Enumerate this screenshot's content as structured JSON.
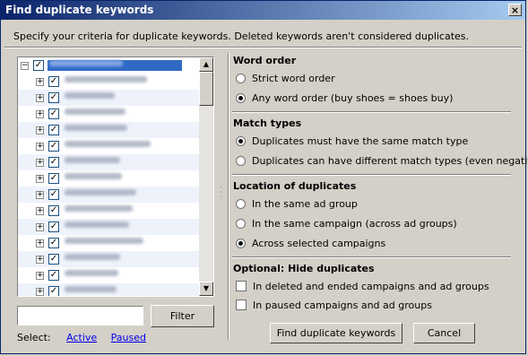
{
  "window": {
    "title": "Find duplicate keywords",
    "close_label": "×"
  },
  "instruction": "Specify your criteria for duplicate keywords. Deleted keywords aren't considered duplicates.",
  "tree": {
    "root_expander": "−",
    "expander": "+",
    "check": "✓",
    "rows": 15
  },
  "filter": {
    "value": "",
    "button_label": "Filter"
  },
  "select": {
    "label": "Select:",
    "active_label": "Active",
    "paused_label": "Paused"
  },
  "word_order": {
    "title": "Word order",
    "options": [
      "Strict word order",
      "Any word order (buy shoes = shoes buy)"
    ],
    "selected_index": 1
  },
  "match_types": {
    "title": "Match types",
    "options": [
      "Duplicates must have the same match type",
      "Duplicates can have different match types (even negatives)"
    ],
    "selected_index": 0
  },
  "location": {
    "title": "Location of duplicates",
    "options": [
      "In the same ad group",
      "In the same campaign (across ad groups)",
      "Across selected campaigns"
    ],
    "selected_index": 2
  },
  "hide": {
    "title": "Optional: Hide duplicates",
    "options": [
      "In deleted and ended campaigns and ad groups",
      "In paused campaigns and ad groups"
    ]
  },
  "actions": {
    "find_label": "Find duplicate keywords",
    "cancel_label": "Cancel"
  }
}
